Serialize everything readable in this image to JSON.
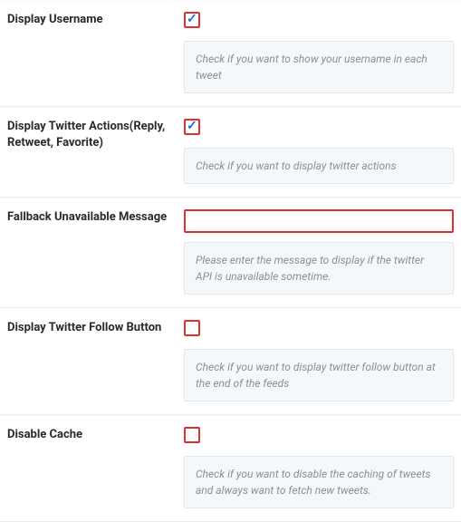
{
  "settings": [
    {
      "label": "Display Username",
      "type": "checkbox",
      "checked": true,
      "help": "Check if you want to show your username in each tweet"
    },
    {
      "label": "Display Twitter Actions(Reply, Retweet, Favorite)",
      "type": "checkbox",
      "checked": true,
      "help": "Check if you want to display twitter actions"
    },
    {
      "label": "Fallback Unavailable Message",
      "type": "text",
      "value": "",
      "help": "Please enter the message to display if the twitter API is unavailable sometime."
    },
    {
      "label": "Display Twitter Follow Button",
      "type": "checkbox",
      "checked": false,
      "help": "Check if you want to display twitter follow button at the end of the feeds"
    },
    {
      "label": "Disable Cache",
      "type": "checkbox",
      "checked": false,
      "help": "Check if you want to disable the caching of tweets and always want to fetch new tweets."
    }
  ]
}
